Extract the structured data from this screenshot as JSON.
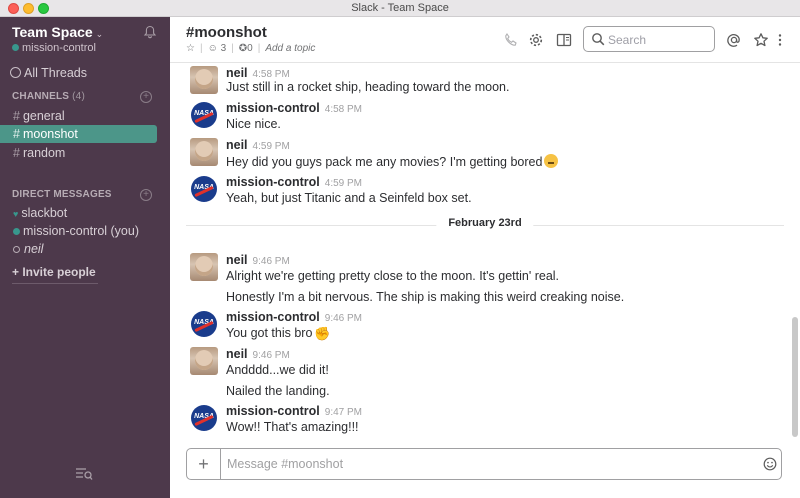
{
  "window": {
    "title": "Slack - Team Space"
  },
  "sidebar": {
    "team_name": "Team Space",
    "team_chevron": "⌄",
    "user": "mission-control",
    "all_threads": "All Threads",
    "channels_title": "CHANNELS",
    "channels_count": "(4)",
    "channels": [
      {
        "name": "general",
        "active": false
      },
      {
        "name": "moonshot",
        "active": true
      },
      {
        "name": "random",
        "active": false
      }
    ],
    "dm_title": "DIRECT MESSAGES",
    "dms": [
      {
        "name": "slackbot",
        "status": "heart"
      },
      {
        "name": "mission-control (you)",
        "status": "heart"
      },
      {
        "name": "neil",
        "status": "away"
      }
    ],
    "invite": "+ Invite people",
    "icons": {
      "bell": "bell-icon",
      "threads": "threads-icon",
      "search_list": "search-list-icon"
    }
  },
  "header": {
    "channel": "#moonshot",
    "members": "3",
    "pins": "0",
    "add_topic": "Add a topic",
    "search_placeholder": "Search",
    "icons": [
      "star-icon",
      "member-icon",
      "pin-icon",
      "phone-icon",
      "gear-icon",
      "sidebar-toggle-icon",
      "search-icon",
      "at-icon",
      "star-icon",
      "more-icon"
    ]
  },
  "messages": [
    {
      "author": "neil",
      "time": "4:58 PM",
      "avatar": "neil",
      "lines": [
        "Just still in a rocket ship, heading toward the moon."
      ]
    },
    {
      "author": "mission-control",
      "time": "4:58 PM",
      "avatar": "nasa",
      "lines": [
        "Nice nice."
      ]
    },
    {
      "author": "neil",
      "time": "4:59 PM",
      "avatar": "neil",
      "lines": [
        "Hey did you guys pack me any movies? I'm getting bored"
      ]
    },
    {
      "author": "mission-control",
      "time": "4:59 PM",
      "avatar": "nasa",
      "lines": [
        "Yeah, but just Titanic and a Seinfeld box set."
      ]
    },
    {
      "author": "neil",
      "time": "9:46 PM",
      "avatar": "neil",
      "lines": [
        "Alright we're getting pretty close to the moon. It's gettin' real.",
        "Honestly I'm a bit nervous. The ship is making this weird creaking noise."
      ]
    },
    {
      "author": "mission-control",
      "time": "9:46 PM",
      "avatar": "nasa",
      "lines": [
        "You got this bro"
      ]
    },
    {
      "author": "neil",
      "time": "9:46 PM",
      "avatar": "neil",
      "lines": [
        "Andddd...we did it!",
        "Nailed the landing."
      ]
    },
    {
      "author": "mission-control",
      "time": "9:47 PM",
      "avatar": "nasa",
      "lines": [
        "Wow!! That's amazing!!!"
      ]
    }
  ],
  "avatar_text": {
    "nasa": "NASA"
  },
  "date_divider": "February 23rd",
  "composer": {
    "placeholder": "Message #moonshot",
    "plus": "+"
  },
  "colors": {
    "sidebar_bg": "#4d394b",
    "active_channel": "#4c9689",
    "presence": "#38978d"
  }
}
